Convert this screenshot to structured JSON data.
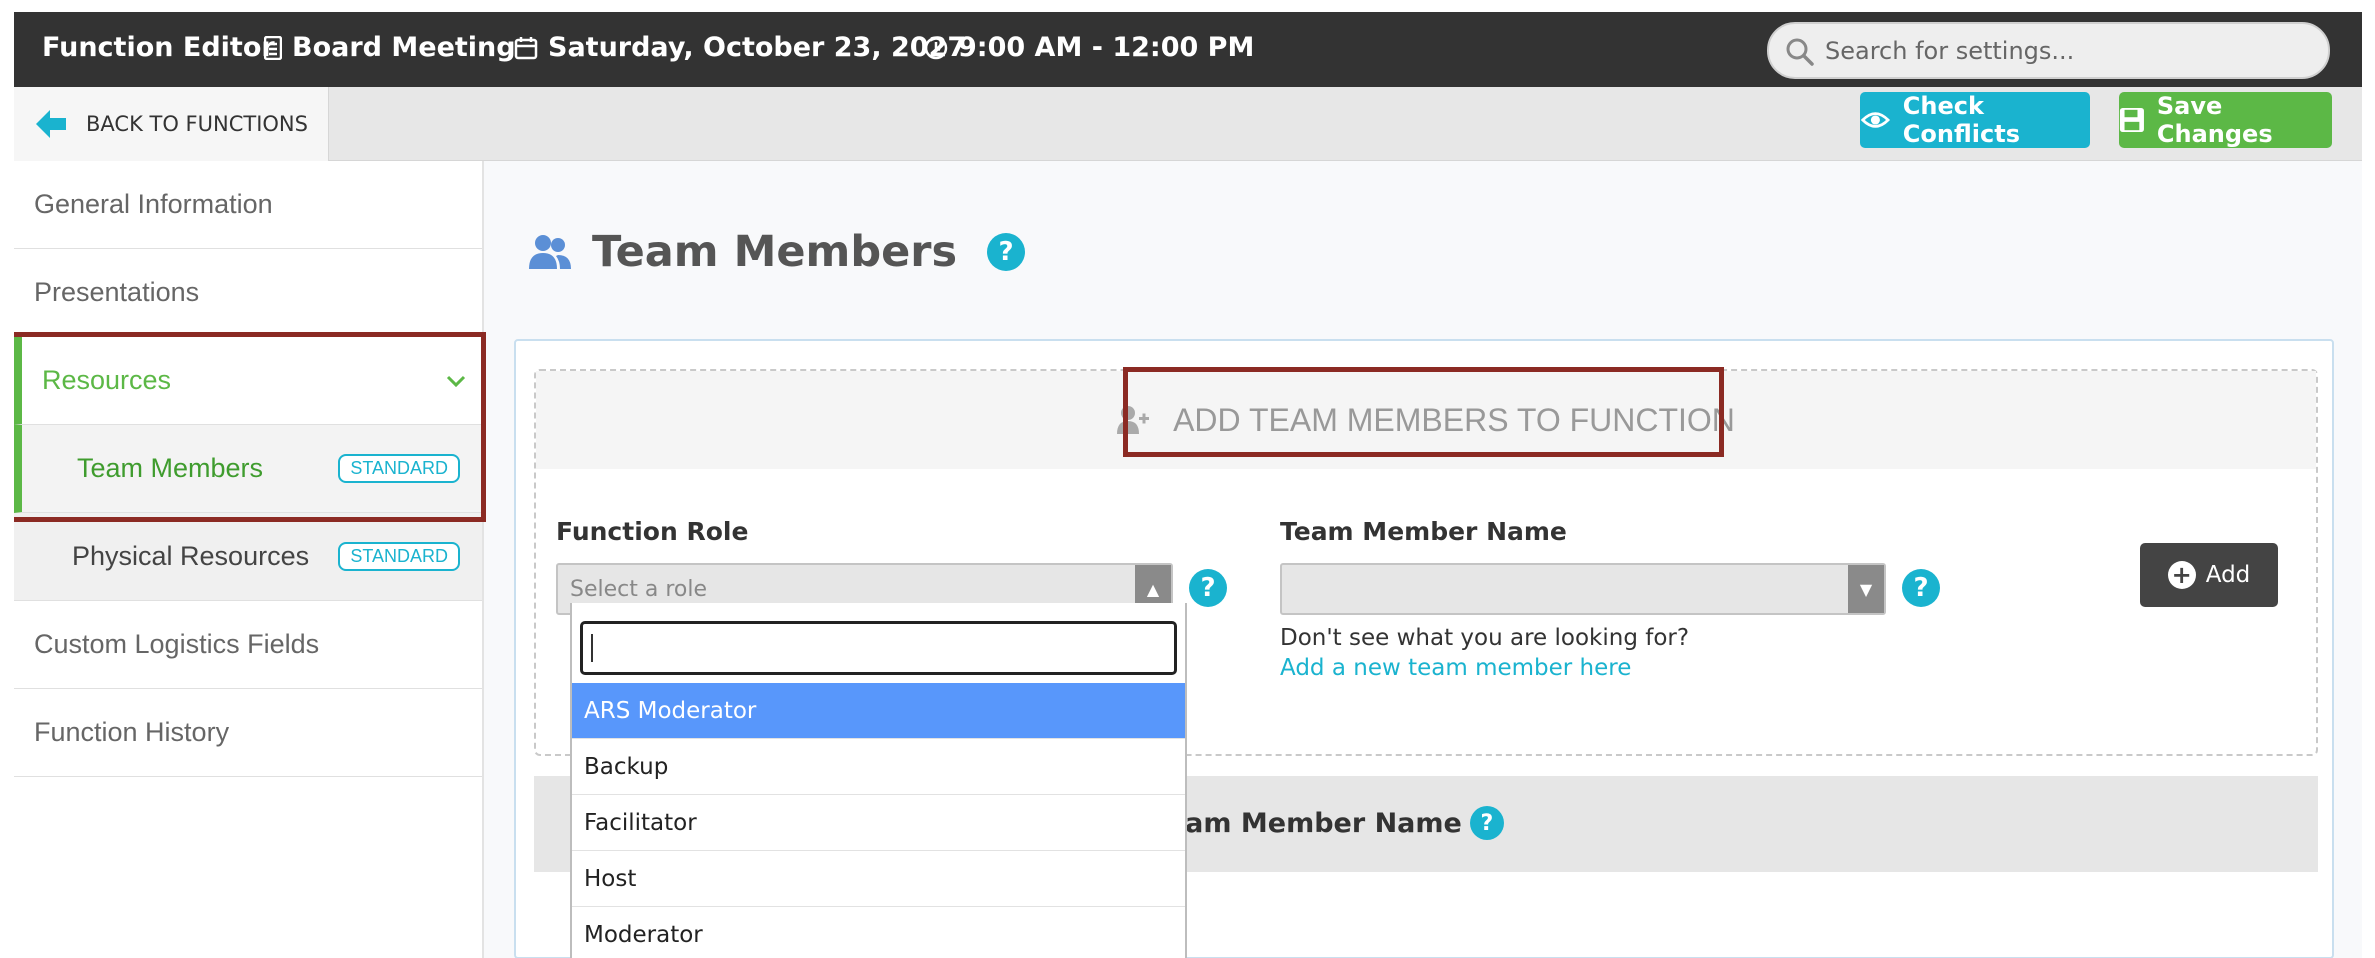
{
  "topbar": {
    "title": "Function Editor",
    "event_name": "Board Meeting",
    "date": "Saturday, October 23, 2027",
    "time": "9:00 AM - 12:00 PM",
    "search_placeholder": "Search for settings..."
  },
  "subbar": {
    "back_label": "BACK TO FUNCTIONS",
    "check_conflicts_label": "Check Conflicts",
    "save_label": "Save Changes"
  },
  "sidebar": {
    "items": [
      {
        "label": "General Information"
      },
      {
        "label": "Presentations"
      },
      {
        "label": "Resources"
      },
      {
        "label": "Team Members",
        "badge": "STANDARD"
      },
      {
        "label": "Physical Resources",
        "badge": "STANDARD"
      },
      {
        "label": "Custom Logistics Fields"
      },
      {
        "label": "Function History"
      }
    ]
  },
  "main": {
    "title": "Team Members",
    "help_glyph": "?",
    "add_header": "ADD TEAM MEMBERS TO FUNCTION",
    "function_role_label": "Function Role",
    "function_role_placeholder": "Select a role",
    "team_member_label": "Team Member Name",
    "hint_text": "Don't see what you are looking for?",
    "add_link": "Add a new team member here",
    "add_button": "Add",
    "table_header_name": "Team Member Name"
  },
  "dropdown": {
    "search_value": "",
    "options": [
      "ARS Moderator",
      "Backup",
      "Facilitator",
      "Host",
      "Moderator"
    ],
    "selected": "ARS Moderator"
  },
  "colors": {
    "accent_teal": "#1ab3cf",
    "accent_green": "#5cb846",
    "topbar": "#333333",
    "highlight": "#8b2a23",
    "option_selected": "#5897fb"
  }
}
